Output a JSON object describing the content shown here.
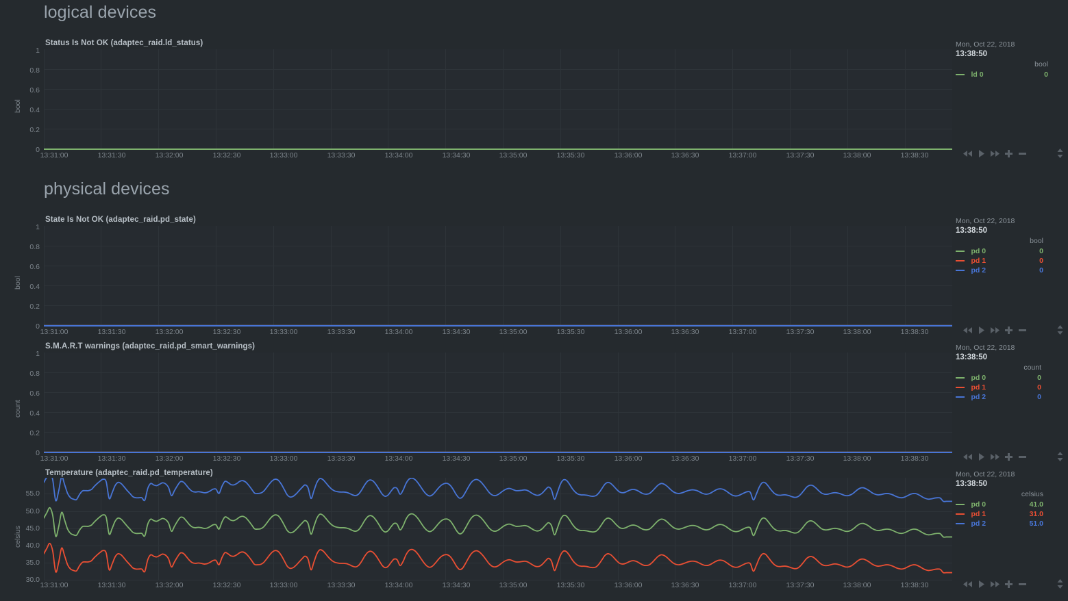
{
  "sections": [
    {
      "title": "logical devices"
    },
    {
      "title": "physical devices"
    }
  ],
  "panels": [
    {
      "id": "ld-status",
      "title": "Status Is Not OK (adaptec_raid.ld_status)",
      "axis_unit": "bool",
      "yticks": [
        "1",
        "0.8",
        "0.6",
        "0.4",
        "0.2",
        "0"
      ],
      "ylim": [
        0,
        1
      ],
      "legend": {
        "date": "Mon, Oct 22, 2018",
        "time": "13:38:50",
        "unit": "bool",
        "series": [
          {
            "name": "ld 0",
            "value": "0",
            "color": "#7EB26D"
          }
        ]
      }
    },
    {
      "id": "pd-state",
      "title": "State Is Not OK (adaptec_raid.pd_state)",
      "axis_unit": "bool",
      "yticks": [
        "1",
        "0.8",
        "0.6",
        "0.4",
        "0.2",
        "0"
      ],
      "ylim": [
        0,
        1
      ],
      "legend": {
        "date": "Mon, Oct 22, 2018",
        "time": "13:38:50",
        "unit": "bool",
        "series": [
          {
            "name": "pd 0",
            "value": "0",
            "color": "#7EB26D"
          },
          {
            "name": "pd 1",
            "value": "0",
            "color": "#EA4F33"
          },
          {
            "name": "pd 2",
            "value": "0",
            "color": "#4875D6"
          }
        ]
      }
    },
    {
      "id": "pd-smart",
      "title": "S.M.A.R.T warnings (adaptec_raid.pd_smart_warnings)",
      "axis_unit": "count",
      "yticks": [
        "1",
        "0.8",
        "0.6",
        "0.4",
        "0.2",
        "0"
      ],
      "ylim": [
        0,
        1
      ],
      "legend": {
        "date": "Mon, Oct 22, 2018",
        "time": "13:38:50",
        "unit": "count",
        "series": [
          {
            "name": "pd 0",
            "value": "0",
            "color": "#7EB26D"
          },
          {
            "name": "pd 1",
            "value": "0",
            "color": "#EA4F33"
          },
          {
            "name": "pd 2",
            "value": "0",
            "color": "#4875D6"
          }
        ]
      }
    },
    {
      "id": "pd-temp",
      "title": "Temperature (adaptec_raid.pd_temperature)",
      "axis_unit": "celsius",
      "yticks": [
        "55.0",
        "50.0",
        "45.0",
        "40.0",
        "35.0",
        "30.0"
      ],
      "ylim": [
        28.8,
        57.6
      ],
      "legend": {
        "date": "Mon, Oct 22, 2018",
        "time": "13:38:50",
        "unit": "celsius",
        "series": [
          {
            "name": "pd 0",
            "value": "41.0",
            "color": "#7EB26D"
          },
          {
            "name": "pd 1",
            "value": "31.0",
            "color": "#EA4F33"
          },
          {
            "name": "pd 2",
            "value": "51.0",
            "color": "#4875D6"
          }
        ]
      }
    }
  ],
  "xticks": [
    "13:31:00",
    "13:31:30",
    "13:32:00",
    "13:32:30",
    "13:33:00",
    "13:33:30",
    "13:34:00",
    "13:34:30",
    "13:35:00",
    "13:35:30",
    "13:36:00",
    "13:36:30",
    "13:37:00",
    "13:37:30",
    "13:38:00",
    "13:38:30"
  ],
  "controls": [
    {
      "name": "rewind-button",
      "glyph": "rewind"
    },
    {
      "name": "play-button",
      "glyph": "play"
    },
    {
      "name": "fast-forward-button",
      "glyph": "fast-forward"
    },
    {
      "name": "zoom-in-button",
      "glyph": "plus"
    },
    {
      "name": "zoom-out-button",
      "glyph": "minus"
    },
    {
      "name": "resize-handle",
      "glyph": "updown"
    }
  ],
  "chart_data": {
    "type": "line",
    "title": "Temperature (adaptec_raid.pd_temperature)",
    "xlabel": "",
    "ylabel": "celsius",
    "ylim": [
      28.8,
      57.6
    ],
    "yticks": [
      30.0,
      35.0,
      40.0,
      45.0,
      50.0,
      55.0
    ],
    "xlim": [
      "13:31:00",
      "13:38:50"
    ],
    "xticks": [
      "13:31:00",
      "13:31:30",
      "13:32:00",
      "13:32:30",
      "13:33:00",
      "13:33:30",
      "13:34:00",
      "13:34:30",
      "13:35:00",
      "13:35:30",
      "13:36:00",
      "13:36:30",
      "13:37:00",
      "13:37:30",
      "13:38:00",
      "13:38:30"
    ],
    "grid": true,
    "legend_position": "right",
    "series": [
      {
        "name": "pd 0",
        "color": "#7EB26D",
        "unit": "celsius",
        "last_value": 41.0,
        "values": [
          46.3,
          47.8,
          49.2,
          47.0,
          41.2,
          43.9,
          47.9,
          45.7,
          43.2,
          42.0,
          41.6,
          41.5,
          42.9,
          43.9,
          44.0,
          44.0,
          44.3,
          45.2,
          46.0,
          46.7,
          47.2,
          46.5,
          41.8,
          43.4,
          45.4,
          46.3,
          46.0,
          45.1,
          44.1,
          43.2,
          42.3,
          42.0,
          42.0,
          42.0,
          41.3,
          44.6,
          46.0,
          45.6,
          45.4,
          45.8,
          46.2,
          45.9,
          44.9,
          42.6,
          44.0,
          45.4,
          46.5,
          46.4,
          45.5,
          44.5,
          43.8,
          43.6,
          43.7,
          43.6,
          43.4,
          43.5,
          43.9,
          44.4,
          44.4,
          43.2,
          45.2,
          46.6,
          46.3,
          45.7,
          45.6,
          46.0,
          46.6,
          46.8,
          46.4,
          45.5,
          44.4,
          43.3,
          43.2,
          43.3,
          43.8,
          44.8,
          45.9,
          46.8,
          47.2,
          46.9,
          45.8,
          44.3,
          42.8,
          42.2,
          42.4,
          43.1,
          44.0,
          44.9,
          45.6,
          44.8,
          41.8,
          44.0,
          46.3,
          47.4,
          47.1,
          46.2,
          45.2,
          44.4,
          43.9,
          43.7,
          43.6,
          43.6,
          43.5,
          43.2,
          42.8,
          42.6,
          43.0,
          44.1,
          45.5,
          46.6,
          47.0,
          46.6,
          45.6,
          44.3,
          43.0,
          42.4,
          42.8,
          43.9,
          44.8,
          44.6,
          43.0,
          44.1,
          46.0,
          47.2,
          47.5,
          47.1,
          46.2,
          45.0,
          43.8,
          42.9,
          42.5,
          42.9,
          43.8,
          44.8,
          45.6,
          46.0,
          46.0,
          45.4,
          44.2,
          42.8,
          41.9,
          42.2,
          43.5,
          45.0,
          46.3,
          47.0,
          47.1,
          46.6,
          45.7,
          44.6,
          43.5,
          42.8,
          42.6,
          42.9,
          43.5,
          44.1,
          44.5,
          44.6,
          44.3,
          44.0,
          44.0,
          44.1,
          44.2,
          44.0,
          43.5,
          43.0,
          42.7,
          42.8,
          43.4,
          44.3,
          45.0,
          44.2,
          41.6,
          43.5,
          45.8,
          47.0,
          46.9,
          45.9,
          44.6,
          43.6,
          43.0,
          42.8,
          42.8,
          42.7,
          42.5,
          42.4,
          42.6,
          43.4,
          44.6,
          45.8,
          46.3,
          46.0,
          45.2,
          44.3,
          43.6,
          43.4,
          43.6,
          44.0,
          44.3,
          44.3,
          44.0,
          43.5,
          43.1,
          43.0,
          43.2,
          43.9,
          44.8,
          45.6,
          46.0,
          45.8,
          45.2,
          44.4,
          43.7,
          43.3,
          43.2,
          43.4,
          43.7,
          44.0,
          44.2,
          44.2,
          44.0,
          43.6,
          43.2,
          43.0,
          43.1,
          43.5,
          44.0,
          44.4,
          44.5,
          44.3,
          43.8,
          43.2,
          42.7,
          42.5,
          42.6,
          43.0,
          43.4,
          43.7,
          43.5,
          41.4,
          43.0,
          45.0,
          46.2,
          46.2,
          45.3,
          44.2,
          43.3,
          42.8,
          42.7,
          42.8,
          42.8,
          42.6,
          42.3,
          42.1,
          42.3,
          43.0,
          44.0,
          45.0,
          45.5,
          45.4,
          44.8,
          44.0,
          43.3,
          43.0,
          43.0,
          43.2,
          43.4,
          43.4,
          43.2,
          42.9,
          42.6,
          42.6,
          42.9,
          43.5,
          44.2,
          44.7,
          44.8,
          44.5,
          44.0,
          43.4,
          43.0,
          42.8,
          42.9,
          43.1,
          43.2,
          43.1,
          42.8,
          42.4,
          42.1,
          42.0,
          42.2,
          42.6,
          43.0,
          43.2,
          43.1,
          42.7,
          42.2,
          41.8,
          41.6,
          41.7,
          41.9,
          42.0,
          41.9,
          41.0,
          41.0,
          41.0,
          41.0
        ]
      },
      {
        "name": "pd 1",
        "color": "#EA4F33",
        "unit": "celsius",
        "offset_from_pd0": -10.0,
        "last_value": 31.0
      },
      {
        "name": "pd 2",
        "color": "#4875D6",
        "unit": "celsius",
        "offset_from_pd0": 10.0,
        "last_value": 51.0
      }
    ]
  },
  "flat_series_value": 0
}
